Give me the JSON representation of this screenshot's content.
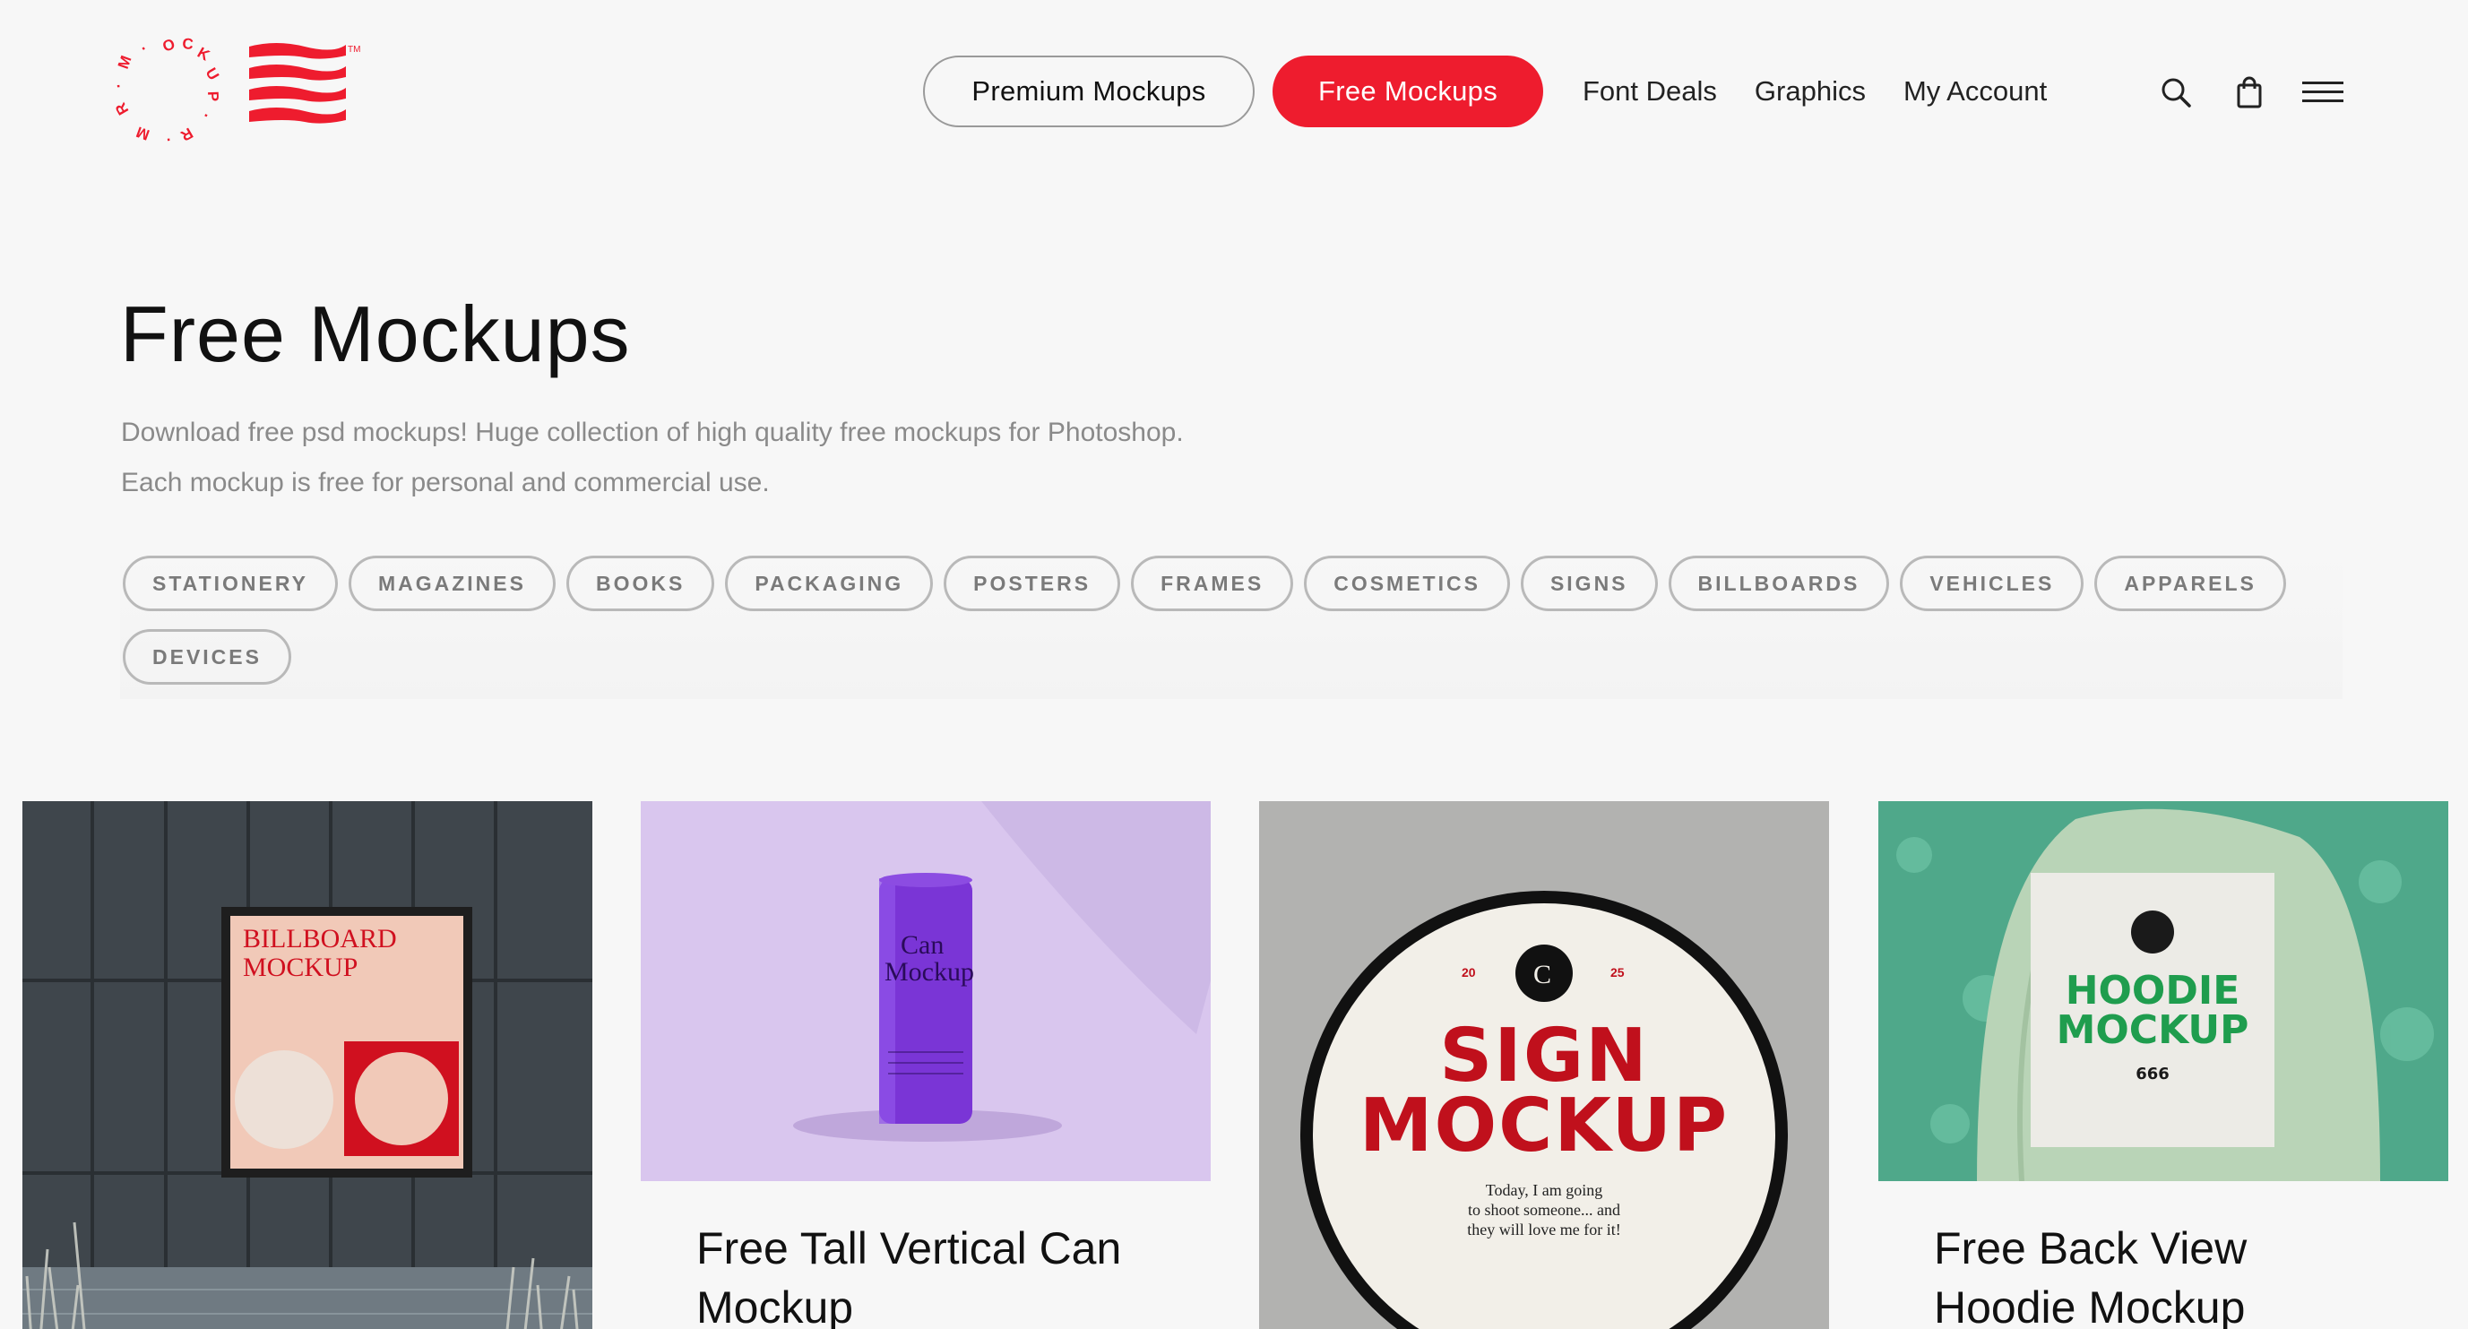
{
  "header": {
    "logo_text": "MOCKUP MR",
    "nav": {
      "premium": "Premium Mockups",
      "free": "Free Mockups",
      "font_deals": "Font Deals",
      "graphics": "Graphics",
      "account": "My Account"
    },
    "icons": [
      "search-icon",
      "shopping-bag-icon",
      "hamburger-menu-icon"
    ]
  },
  "hero": {
    "title": "Free Mockups",
    "description_line1": "Download free psd mockups! Huge collection of high quality free mockups for Photoshop.",
    "description_line2": "Each mockup is free for personal and commercial use."
  },
  "categories": [
    "STATIONERY",
    "MAGAZINES",
    "BOOKS",
    "PACKAGING",
    "POSTERS",
    "FRAMES",
    "COSMETICS",
    "SIGNS",
    "BILLBOARDS",
    "VEHICLES",
    "APPARELS",
    "DEVICES"
  ],
  "cards": [
    {
      "title": "",
      "image_text": {
        "line1": "BILLBOARD",
        "line2": "MOCKUP"
      }
    },
    {
      "title": "Free Tall Vertical Can Mockup",
      "image_text": {
        "line1": "Can",
        "line2": "Mockup"
      }
    },
    {
      "title": "",
      "image_text": {
        "year_left": "20",
        "year_right": "25",
        "line1": "SIGN",
        "line2": "MOCKUP",
        "caption1": "Today, I am going",
        "caption2": "to shoot someone... and",
        "caption3": "they will love me for it!"
      }
    },
    {
      "title": "Free Back View Hoodie Mockup",
      "image_text": {
        "line1": "HOODIE",
        "line2": "MOCKUP",
        "line3": "666"
      }
    }
  ],
  "colors": {
    "brand_red": "#ee1c2e",
    "background": "#f7f7f7",
    "muted_text": "#8a8a8a",
    "pill_border": "#b9b9b9"
  }
}
